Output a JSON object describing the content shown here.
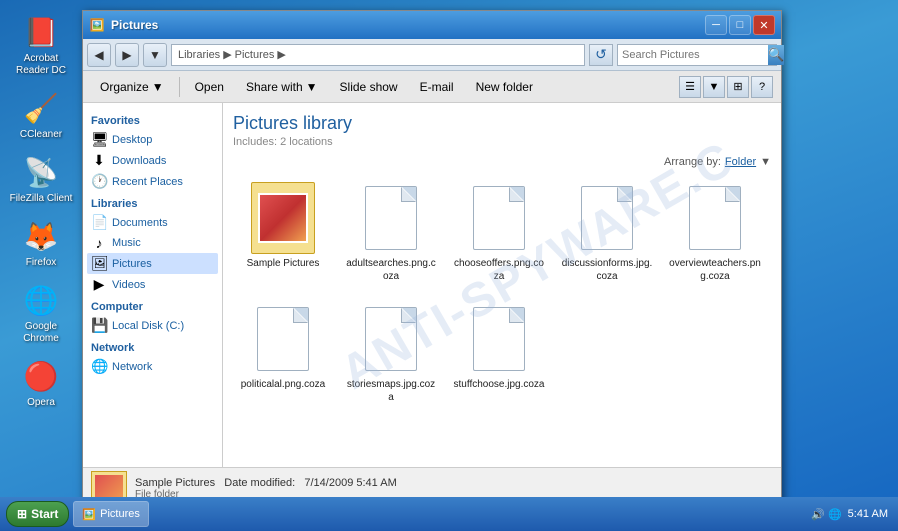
{
  "window": {
    "title": "Pictures",
    "icon": "🖼️"
  },
  "titlebar": {
    "minimize": "─",
    "maximize": "□",
    "close": "✕"
  },
  "addressbar": {
    "back_title": "Back",
    "forward_title": "Forward",
    "up_title": "Up",
    "path_libraries": "Libraries",
    "path_pictures": "Pictures",
    "go_title": "Go",
    "search_placeholder": "Search Pictures",
    "search_btn": "🔍"
  },
  "toolbar": {
    "organize": "Organize",
    "open": "Open",
    "share_with": "Share with",
    "slide_show": "Slide show",
    "email": "E-mail",
    "new_folder": "New folder"
  },
  "sidebar": {
    "favorites_label": "Favorites",
    "favorites_items": [
      {
        "label": "Desktop",
        "icon": "🖥"
      },
      {
        "label": "Downloads",
        "icon": "⬇"
      },
      {
        "label": "Recent Places",
        "icon": "🕐"
      }
    ],
    "libraries_label": "Libraries",
    "libraries_items": [
      {
        "label": "Documents",
        "icon": "📄"
      },
      {
        "label": "Music",
        "icon": "♪"
      },
      {
        "label": "Pictures",
        "icon": "🖼",
        "selected": true
      },
      {
        "label": "Videos",
        "icon": "▶"
      }
    ],
    "computer_label": "Computer",
    "computer_items": [
      {
        "label": "Local Disk (C:)",
        "icon": "💾"
      }
    ],
    "network_label": "Network",
    "network_items": [
      {
        "label": "Network",
        "icon": "🌐"
      }
    ]
  },
  "content": {
    "title": "Pictures library",
    "subtitle": "Includes: 2 locations",
    "arrange_label": "Arrange by:",
    "arrange_value": "Folder",
    "files": [
      {
        "name": "Sample Pictures",
        "type": "sample_folder"
      },
      {
        "name": "adultsearches.png.coza",
        "type": "file"
      },
      {
        "name": "chooseoffers.png.coza",
        "type": "file"
      },
      {
        "name": "discussionforms.jpg.coza",
        "type": "file"
      },
      {
        "name": "overviewteachers.png.coza",
        "type": "file"
      },
      {
        "name": "politicalal.png.coza",
        "type": "file"
      },
      {
        "name": "storiesmaps.jpg.coza",
        "type": "file"
      },
      {
        "name": "stuffchoose.jpg.coza",
        "type": "file"
      }
    ]
  },
  "statusbar": {
    "name": "Sample Pictures",
    "date_label": "Date modified:",
    "date_value": "7/14/2009 5:41 AM",
    "type": "File folder"
  },
  "watermark": {
    "text": "ANTI-SPYWARE.C"
  },
  "desktop_icons": [
    {
      "label": "Acrobat Reader DC",
      "icon": "📕"
    },
    {
      "label": "CCleaner",
      "icon": "🧹"
    },
    {
      "label": "FileZilla Client",
      "icon": "📡"
    },
    {
      "label": "Firefox",
      "icon": "🦊"
    },
    {
      "label": "Google Chrome",
      "icon": "🌐"
    },
    {
      "label": "Opera",
      "icon": "🔴"
    }
  ],
  "taskbar": {
    "start_label": "Start",
    "active_window": "Pictures",
    "time": "5:41 AM"
  }
}
